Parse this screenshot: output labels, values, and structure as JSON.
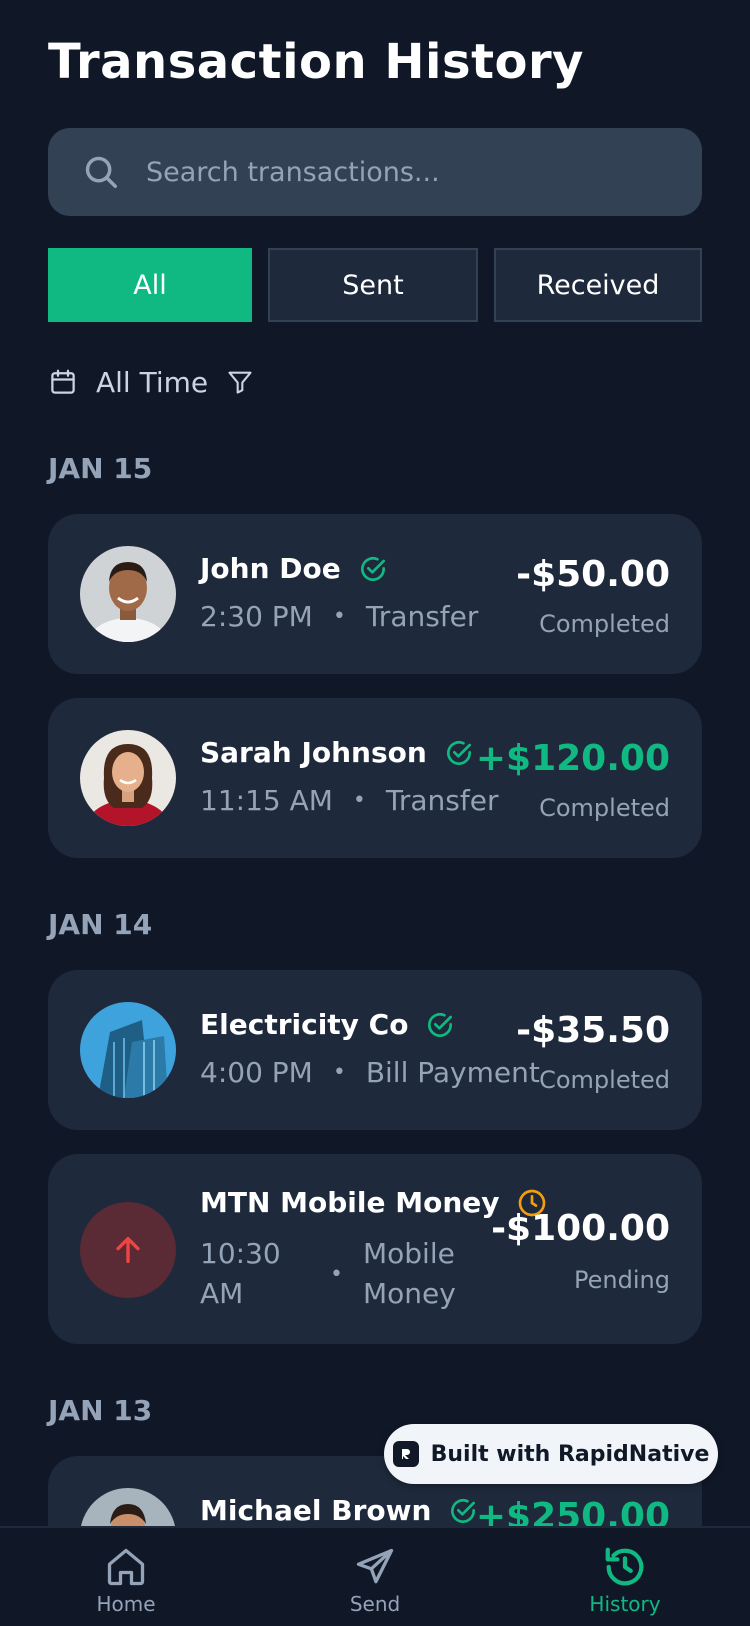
{
  "header": {
    "title": "Transaction History"
  },
  "search": {
    "placeholder": "Search transactions..."
  },
  "tabs": [
    {
      "label": "All",
      "active": true
    },
    {
      "label": "Sent",
      "active": false
    },
    {
      "label": "Received",
      "active": false
    }
  ],
  "filter": {
    "label": "All Time"
  },
  "groups": [
    {
      "date": "JAN 15",
      "transactions": [
        {
          "name": "John Doe",
          "time": "2:30 PM",
          "type": "Transfer",
          "amount": "-$50.00",
          "status": "Completed",
          "status_icon": "check-circle-icon",
          "avatar": "photo-avatar-man"
        },
        {
          "name": "Sarah Johnson",
          "time": "11:15 AM",
          "type": "Transfer",
          "amount": "+$120.00",
          "status": "Completed",
          "status_icon": "check-circle-icon",
          "avatar": "photo-avatar-woman"
        }
      ]
    },
    {
      "date": "JAN 14",
      "transactions": [
        {
          "name": "Electricity Co",
          "time": "4:00 PM",
          "type": "Bill Payment",
          "amount": "-$35.50",
          "status": "Completed",
          "status_icon": "check-circle-icon",
          "avatar": "photo-avatar-building"
        },
        {
          "name": "MTN Mobile Money",
          "time_line1": "10:30",
          "time_line2": "AM",
          "type_line1": "Mobile",
          "type_line2": "Money",
          "amount": "-$100.00",
          "status": "Pending",
          "status_icon": "clock-icon",
          "avatar": "arrow-up-icon"
        }
      ]
    },
    {
      "date": "JAN 13",
      "transactions": [
        {
          "name": "Michael Brown",
          "amount": "+$250.00",
          "status_icon": "check-circle-icon",
          "avatar": "photo-avatar-man-2"
        }
      ]
    }
  ],
  "badge": {
    "label": "Built with RapidNative"
  },
  "nav": [
    {
      "label": "Home",
      "icon": "home-icon",
      "active": false
    },
    {
      "label": "Send",
      "icon": "send-icon",
      "active": false
    },
    {
      "label": "History",
      "icon": "history-icon",
      "active": true
    }
  ],
  "colors": {
    "background": "#101828",
    "card": "#1e293b",
    "accent": "#10b981",
    "positive_amount": "#10b981",
    "pending": "#f59e0b",
    "sent_icon": "#ef4444"
  }
}
